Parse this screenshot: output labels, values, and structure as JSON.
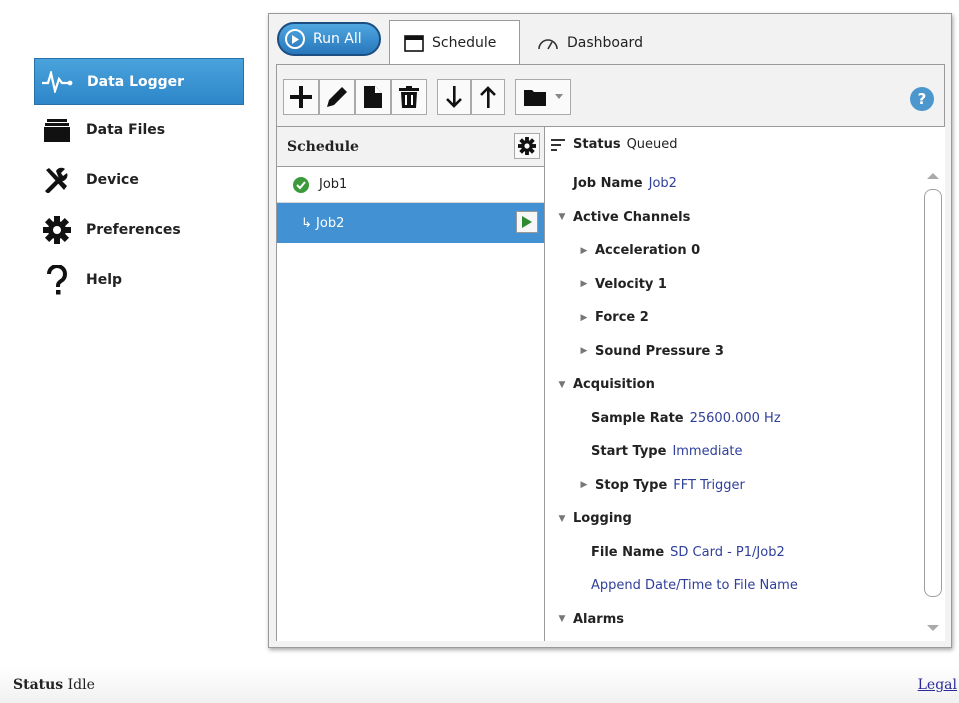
{
  "sidebar": {
    "items": [
      {
        "label": "Data Logger",
        "icon": "waveform-icon"
      },
      {
        "label": "Data Files",
        "icon": "file-drawer-icon"
      },
      {
        "label": "Device",
        "icon": "tools-icon"
      },
      {
        "label": "Preferences",
        "icon": "gear-icon"
      },
      {
        "label": "Help",
        "icon": "question-icon"
      }
    ]
  },
  "tabs": {
    "run_all": "Run All",
    "schedule": "Schedule",
    "dashboard": "Dashboard"
  },
  "schedule_panel": {
    "header": "Schedule",
    "jobs": [
      {
        "label": "Job1",
        "state": "complete"
      },
      {
        "label": "↳ Job2",
        "state": "selected"
      }
    ]
  },
  "properties": {
    "status_label": "Status",
    "status_value": "Queued",
    "job_name_label": "Job Name",
    "job_name_value": "Job2",
    "active_channels": "Active Channels",
    "channels": [
      "Acceleration 0",
      "Velocity 1",
      "Force 2",
      "Sound Pressure 3"
    ],
    "acquisition": "Acquisition",
    "sample_rate_label": "Sample Rate",
    "sample_rate_value": "25600.000 Hz",
    "start_type_label": "Start Type",
    "start_type_value": "Immediate",
    "stop_type_label": "Stop Type",
    "stop_type_value": "FFT Trigger",
    "logging": "Logging",
    "file_name_label": "File Name",
    "file_name_value": "SD Card - P1/Job2",
    "append_label": "Append Date/Time to File Name",
    "alarms": "Alarms"
  },
  "footer": {
    "status_label": "Status",
    "status_value": "Idle",
    "legal": "Legal"
  },
  "colors": {
    "accent": "#2d86c8",
    "selected_row": "#4191d3",
    "value_text": "#2f3f9a",
    "check_green": "#3c9a3c"
  }
}
